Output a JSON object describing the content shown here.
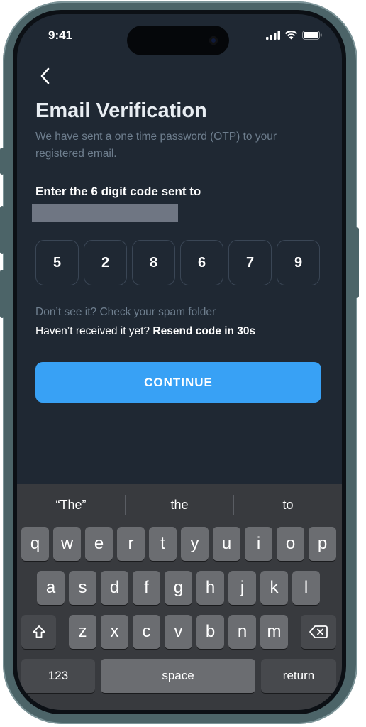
{
  "status_bar": {
    "time": "9:41"
  },
  "header": {
    "title": "Email Verification",
    "subtitle": "We have sent a one time password (OTP) to your registered email."
  },
  "code_prompt": {
    "label": "Enter the 6 digit code sent to"
  },
  "otp": {
    "digits": [
      "5",
      "2",
      "8",
      "6",
      "7",
      "9"
    ]
  },
  "help": {
    "spam_hint": "Don’t see it? Check your spam folder",
    "resend_prefix": "Haven’t received it yet?",
    "resend_link": "Resend code in 30s"
  },
  "actions": {
    "continue_label": "CONTINUE"
  },
  "keyboard": {
    "suggestions": [
      "“The”",
      "the",
      "to"
    ],
    "row1": [
      "q",
      "w",
      "e",
      "r",
      "t",
      "y",
      "u",
      "i",
      "o",
      "p"
    ],
    "row2": [
      "a",
      "s",
      "d",
      "f",
      "g",
      "h",
      "j",
      "k",
      "l"
    ],
    "row3": [
      "z",
      "x",
      "c",
      "v",
      "b",
      "n",
      "m"
    ],
    "numbers_label": "123",
    "space_label": "space",
    "return_label": "return"
  },
  "colors": {
    "background": "#1f2833",
    "accent": "#38a1f5",
    "muted_text": "#6e7e8e",
    "otp_border": "#3a4655",
    "keyboard_bg": "#383a3e",
    "key_bg": "#6b6d71"
  },
  "icons": [
    "back-chevron-icon",
    "signal-icon",
    "wifi-icon",
    "battery-icon",
    "shift-icon",
    "backspace-icon"
  ]
}
